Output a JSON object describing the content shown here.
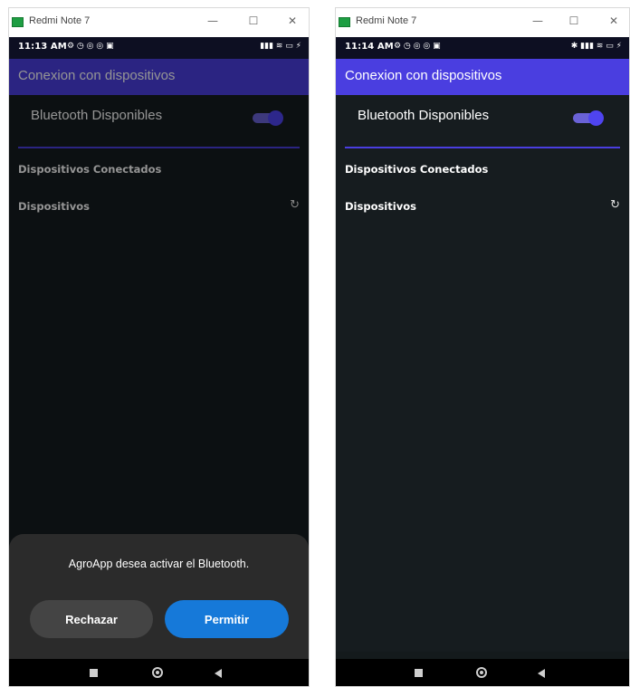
{
  "colors": {
    "appbar_bg": "#4a3ee0",
    "content_bg": "#161c1f",
    "statusbar_bg": "#0d0f22",
    "accent": "#4f44f0",
    "allow_button": "#1679d9",
    "reject_button": "#444444"
  },
  "windows": [
    {
      "title": "Redmi Note 7",
      "status": {
        "time": "11:13 AM",
        "left_icons": "⚙ ◷ ◎ ◎ ▣",
        "right_icons": "▮▮▮ ≋ ▭ ⚡"
      },
      "app": {
        "title": "Conexion con dispositivos",
        "bluetooth_label": "Bluetooth Disponibles",
        "bluetooth_on": true,
        "connected_label": "Dispositivos Conectados",
        "devices_label": "Dispositivos"
      },
      "dialog": {
        "message": "AgroApp desea activar el Bluetooth.",
        "reject_label": "Rechazar",
        "allow_label": "Permitir"
      }
    },
    {
      "title": "Redmi Note 7",
      "status": {
        "time": "11:14 AM",
        "left_icons": "⚙ ◷ ◎ ◎ ▣",
        "right_icons": "✱ ▮▮▮ ≋ ▭ ⚡"
      },
      "app": {
        "title": "Conexion con dispositivos",
        "bluetooth_label": "Bluetooth Disponibles",
        "bluetooth_on": true,
        "connected_label": "Dispositivos Conectados",
        "devices_label": "Dispositivos"
      }
    }
  ],
  "icons": {
    "refresh": "↻",
    "minimize": "—",
    "maximize": "☐",
    "close": "✕"
  }
}
